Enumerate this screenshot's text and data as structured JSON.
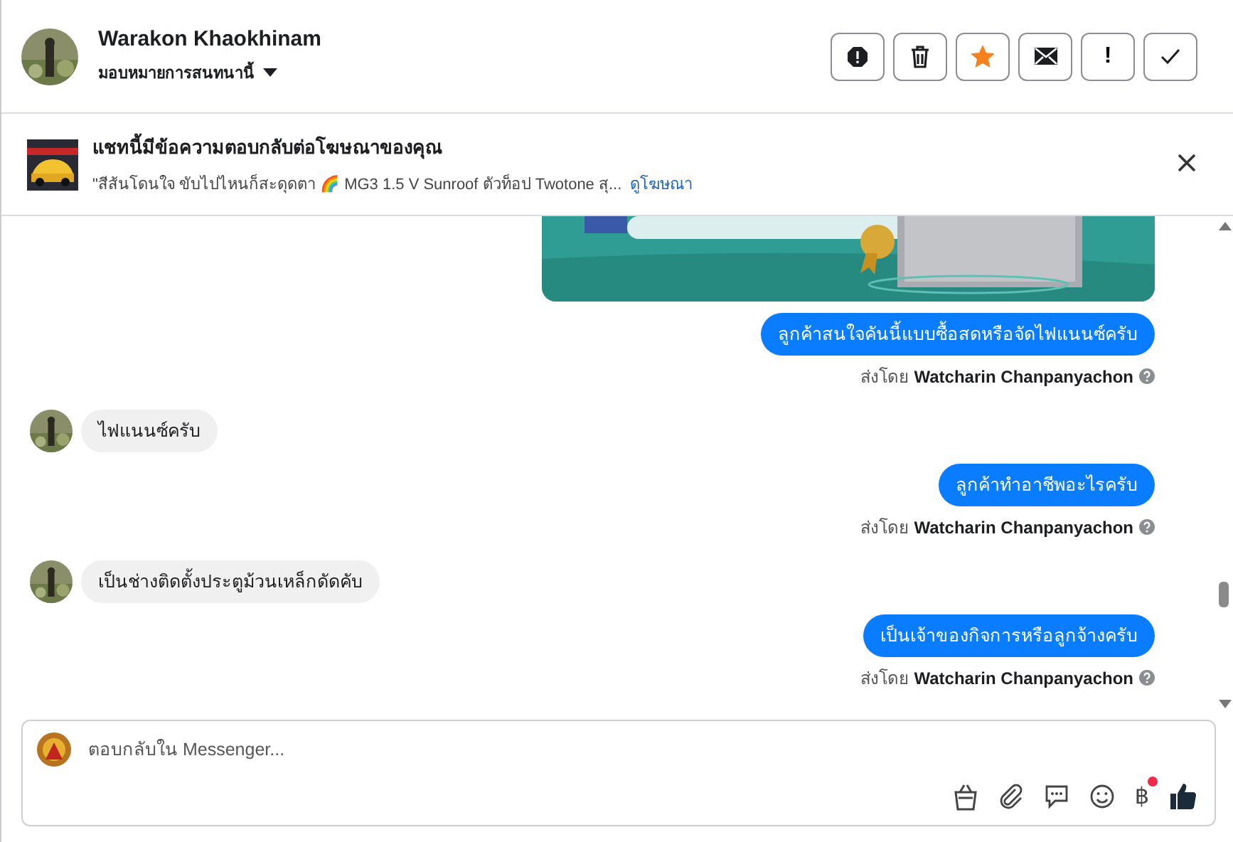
{
  "header": {
    "name": "Warakon Khaokhinam",
    "assign": "มอบหมายการสนทนานี้",
    "actions": [
      {
        "kind": "alert"
      },
      {
        "kind": "trash"
      },
      {
        "kind": "star",
        "on": true
      },
      {
        "kind": "mail"
      },
      {
        "kind": "mark",
        "label": "!"
      },
      {
        "kind": "check"
      }
    ]
  },
  "ad_banner": {
    "title": "แชทนี้มีข้อความตอบกลับต่อโฆษณาของคุณ",
    "snippet": "\"สีส้นโดนใจ ขับไปไหนก็สะดุดตา 🌈 MG3 1.5 V Sunroof ตัวท็อป Twotone สุ...",
    "link": "ดูโฆษณา"
  },
  "messages": [
    {
      "kind": "picture"
    },
    {
      "kind": "outgoing",
      "text": "ลูกค้าสนใจคันนี้แบบซื้อสดหรือจัดไฟแนนซ์ครับ",
      "sent_by": "ส่งโดย",
      "sender": "Watcharin Chanpanyachon"
    },
    {
      "kind": "incoming",
      "text": "ไฟแนนซ์ครับ"
    },
    {
      "kind": "outgoing",
      "text": "ลูกค้าทำอาชีพอะไรครับ",
      "sent_by": "ส่งโดย",
      "sender": "Watcharin Chanpanyachon"
    },
    {
      "kind": "incoming",
      "text": "เป็นช่างติดตั้งประตูม้วนเหล็กดัดคับ"
    },
    {
      "kind": "outgoing",
      "text": "เป็นเจ้าของกิจการหรือลูกจ้างครับ",
      "sent_by": "ส่งโดย",
      "sender": "Watcharin Chanpanyachon"
    }
  ],
  "composer": {
    "placeholder": "ตอบกลับใน Messenger...",
    "tools": [
      {
        "kind": "bag"
      },
      {
        "kind": "clip"
      },
      {
        "kind": "chat"
      },
      {
        "kind": "smile"
      },
      {
        "kind": "baht",
        "label": "฿",
        "badge": true
      },
      {
        "kind": "like"
      }
    ]
  }
}
